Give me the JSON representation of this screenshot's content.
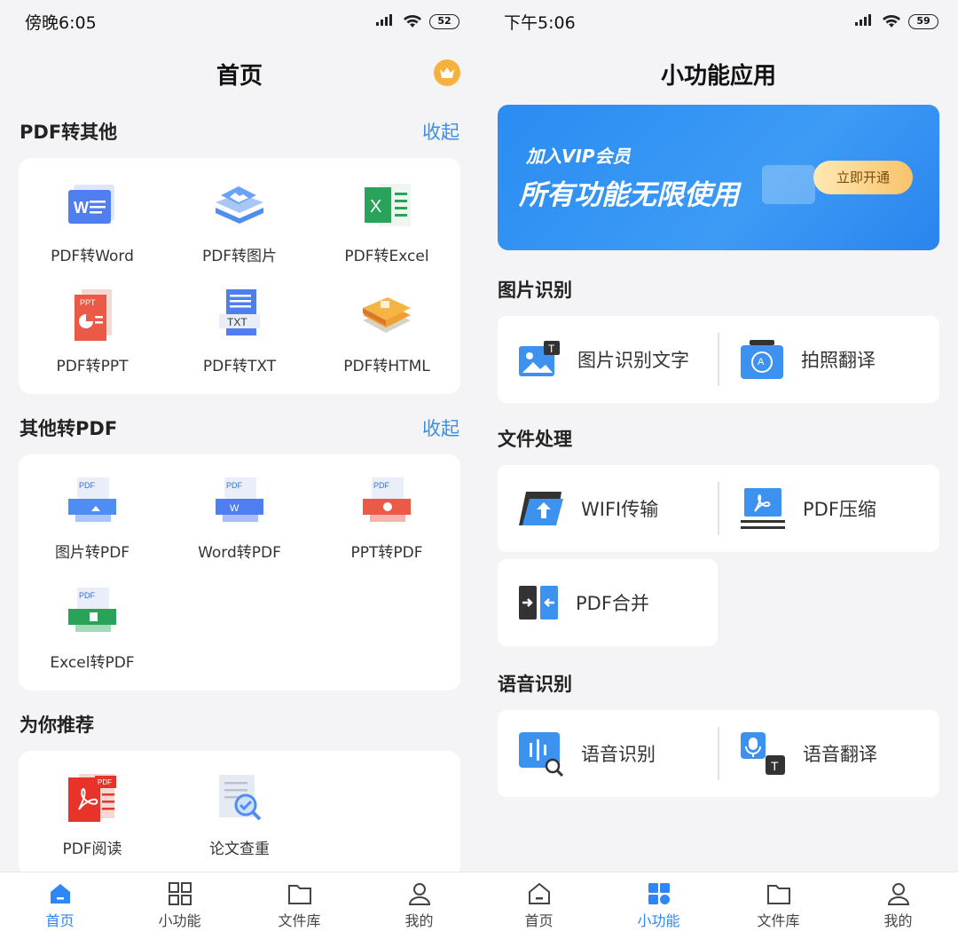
{
  "left": {
    "status": {
      "time": "傍晚6:05",
      "battery": "52"
    },
    "title": "首页",
    "sections": [
      {
        "heading": "PDF转其他",
        "action": "收起",
        "items": [
          {
            "label": "PDF转Word",
            "icon": "word-icon"
          },
          {
            "label": "PDF转图片",
            "icon": "image-icon"
          },
          {
            "label": "PDF转Excel",
            "icon": "excel-icon"
          },
          {
            "label": "PDF转PPT",
            "icon": "ppt-icon"
          },
          {
            "label": "PDF转TXT",
            "icon": "txt-icon"
          },
          {
            "label": "PDF转HTML",
            "icon": "html-icon"
          }
        ]
      },
      {
        "heading": "其他转PDF",
        "action": "收起",
        "items": [
          {
            "label": "图片转PDF",
            "icon": "image-to-pdf-icon"
          },
          {
            "label": "Word转PDF",
            "icon": "word-to-pdf-icon"
          },
          {
            "label": "PPT转PDF",
            "icon": "ppt-to-pdf-icon"
          },
          {
            "label": "Excel转PDF",
            "icon": "excel-to-pdf-icon"
          }
        ]
      },
      {
        "heading": "为你推荐",
        "items": [
          {
            "label": "PDF阅读",
            "icon": "pdf-reader-icon"
          },
          {
            "label": "论文查重",
            "icon": "plagiarism-check-icon"
          }
        ]
      }
    ],
    "tabs": [
      {
        "label": "首页",
        "active": true
      },
      {
        "label": "小功能",
        "active": false
      },
      {
        "label": "文件库",
        "active": false
      },
      {
        "label": "我的",
        "active": false
      }
    ]
  },
  "right": {
    "status": {
      "time": "下午5:06",
      "battery": "59"
    },
    "title": "小功能应用",
    "banner": {
      "line1": "加入VIP会员",
      "line2": "所有功能无限使用",
      "cta": "立即开通"
    },
    "sections": [
      {
        "heading": "图片识别",
        "items": [
          {
            "label": "图片识别文字",
            "icon": "image-text-recognition-icon"
          },
          {
            "label": "拍照翻译",
            "icon": "photo-translate-icon"
          }
        ]
      },
      {
        "heading": "文件处理",
        "items": [
          {
            "label": "WIFI传输",
            "icon": "wifi-transfer-icon"
          },
          {
            "label": "PDF压缩",
            "icon": "pdf-compress-icon"
          },
          {
            "label": "PDF合并",
            "icon": "pdf-merge-icon"
          }
        ]
      },
      {
        "heading": "语音识别",
        "items": [
          {
            "label": "语音识别",
            "icon": "voice-recognition-icon"
          },
          {
            "label": "语音翻译",
            "icon": "voice-translate-icon"
          }
        ]
      }
    ],
    "tabs": [
      {
        "label": "首页",
        "active": false
      },
      {
        "label": "小功能",
        "active": true
      },
      {
        "label": "文件库",
        "active": false
      },
      {
        "label": "我的",
        "active": false
      }
    ]
  },
  "colors": {
    "accent": "#2f86f6",
    "link": "#3a8ee6",
    "vip_gold": "#f4b23c"
  }
}
